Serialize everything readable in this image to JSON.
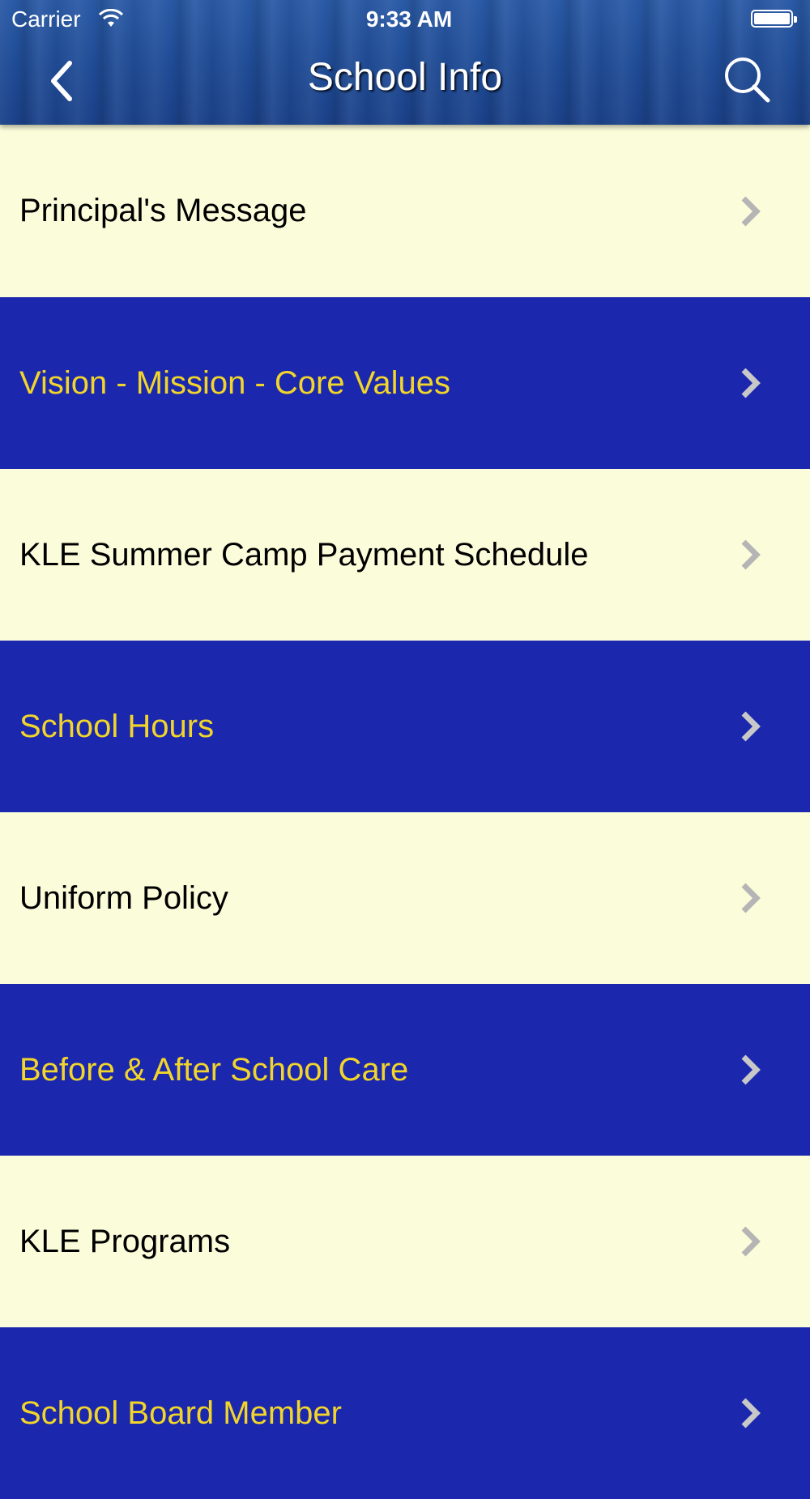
{
  "status_bar": {
    "carrier": "Carrier",
    "wifi_icon": "wifi-icon",
    "time": "9:33 AM",
    "battery_icon": "battery-icon"
  },
  "nav": {
    "title": "School Info",
    "back_icon": "chevron-left-icon",
    "search_icon": "search-icon"
  },
  "colors": {
    "light_row": "#fbfdda",
    "dark_row": "#1b27ad",
    "dark_row_text": "#f2d52a",
    "header": "#1f4b95"
  },
  "items": [
    {
      "label": "Principal's Message",
      "style": "light"
    },
    {
      "label": "Vision - Mission - Core Values",
      "style": "dark"
    },
    {
      "label": "KLE Summer Camp Payment Schedule",
      "style": "light"
    },
    {
      "label": "School Hours",
      "style": "dark"
    },
    {
      "label": "Uniform Policy",
      "style": "light"
    },
    {
      "label": "Before & After School Care",
      "style": "dark"
    },
    {
      "label": "KLE Programs",
      "style": "light"
    },
    {
      "label": "School Board Member",
      "style": "dark"
    }
  ]
}
